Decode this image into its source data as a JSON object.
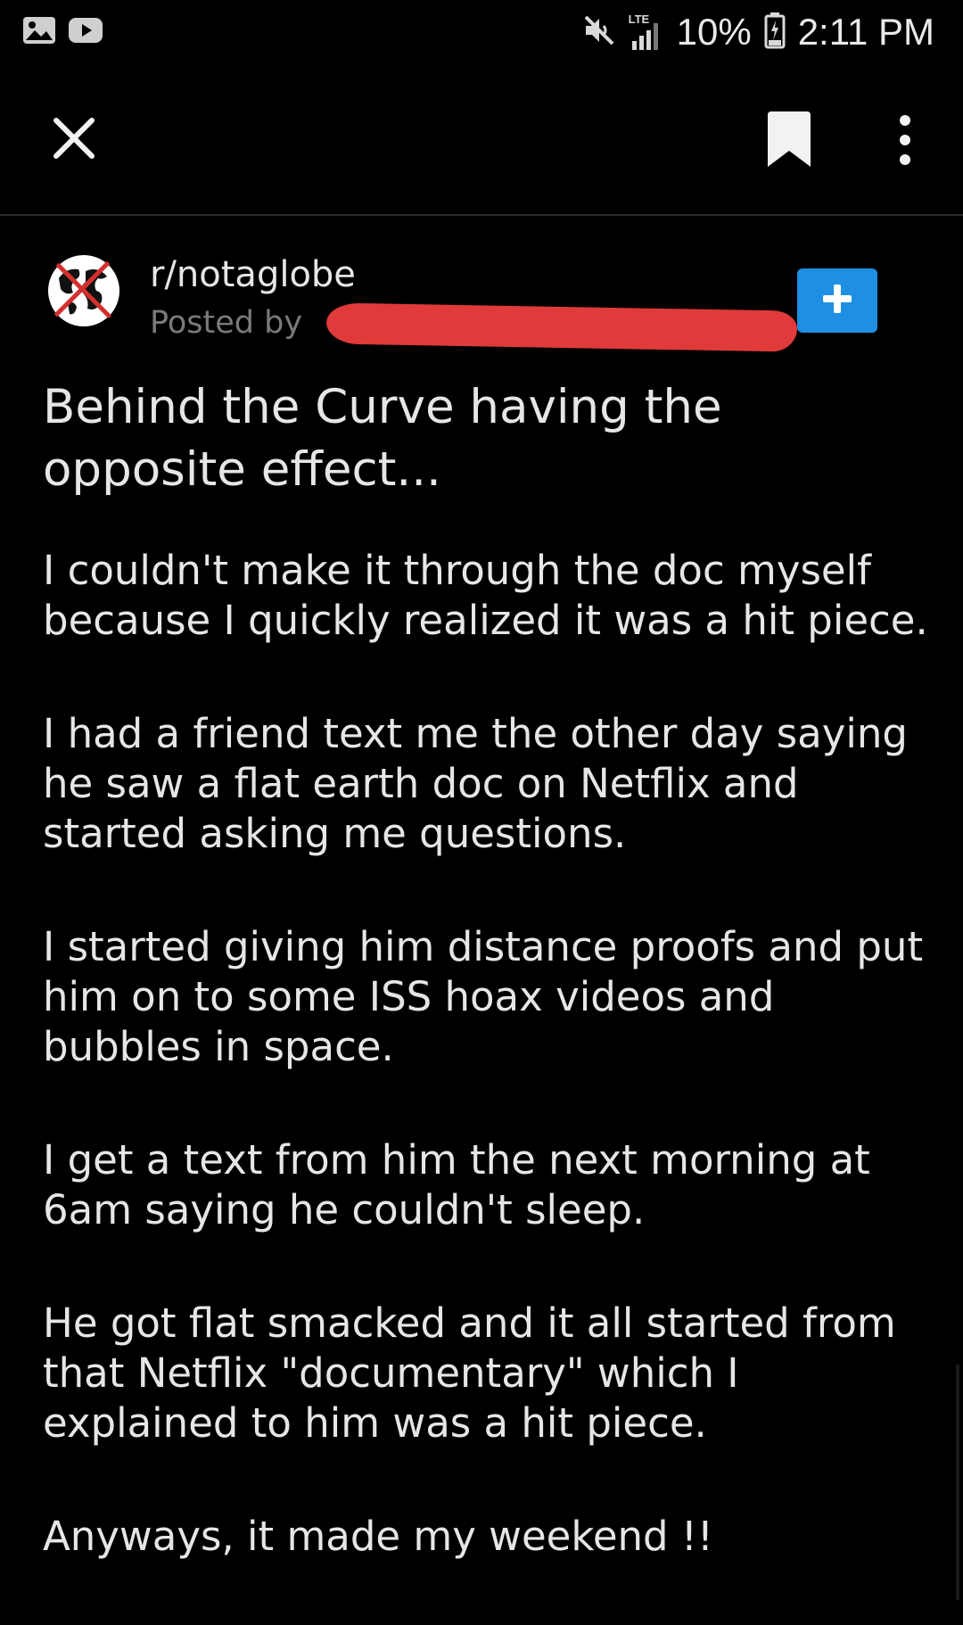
{
  "status_bar": {
    "network_label": "LTE",
    "battery": "10%",
    "time": "2:11 PM",
    "icons": [
      "gallery-icon",
      "youtube-icon",
      "mute-icon",
      "signal-icon",
      "battery-icon"
    ]
  },
  "app_bar": {
    "close_icon": "close-icon",
    "bookmark_icon": "bookmark-icon",
    "more_icon": "more-vertical-icon"
  },
  "post": {
    "subreddit": "r/notaglobe",
    "posted_by_prefix": "Posted by",
    "title": "Behind the Curve having the opposite effect...",
    "paragraphs": [
      "I couldn't make it through the doc myself because I quickly realized it was a hit piece.",
      "I had a friend text me the other day saying he saw a flat earth doc on Netflix and started asking me questions.",
      "I started giving him distance proofs and put him on to some ISS hoax videos and bubbles in space.",
      "I get a text from him the next morning at 6am saying he couldn't sleep.",
      "He got flat smacked and it all started from that Netflix \"documentary\" which I explained to him was a hit piece.",
      "Anyways, it made my weekend !!"
    ],
    "join_icon": "plus-icon"
  },
  "colors": {
    "background": "#000000",
    "text": "#e6e6e6",
    "muted_text": "#7a7a7a",
    "accent": "#1f8fe3",
    "redaction": "#e03a3a"
  }
}
